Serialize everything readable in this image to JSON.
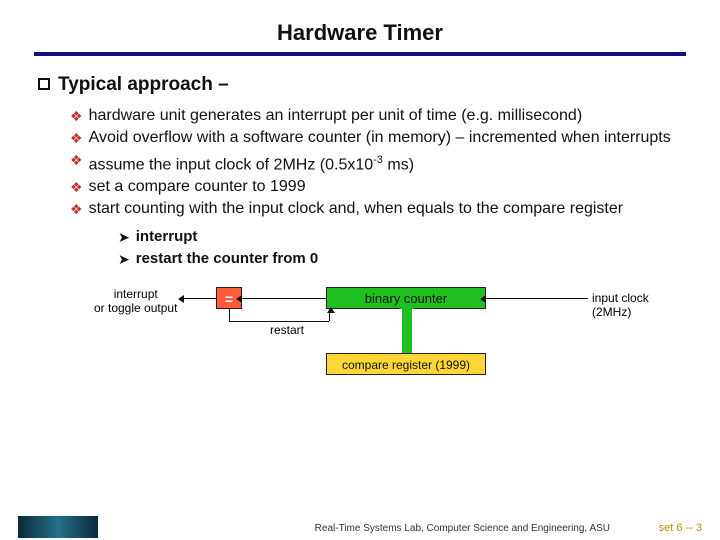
{
  "title": "Hardware Timer",
  "heading": "Typical approach –",
  "bullets2": [
    "hardware unit generates an interrupt per unit of time (e.g. millisecond)",
    "Avoid overflow with a software counter (in memory) – incremented when interrupts",
    "assume the input clock of 2MHz (0.5x10",
    "set a compare counter to 1999",
    "start counting with the input clock and, when equals to the compare register"
  ],
  "bullet2_tail": " ms)",
  "bullet2_sup": "-3",
  "bullets3": [
    "interrupt",
    "restart the counter from 0"
  ],
  "diagram": {
    "interrupt_label_l1": "interrupt",
    "interrupt_label_l2": "or toggle output",
    "eq": "=",
    "counter": "binary counter",
    "clock": "input clock (2MHz)",
    "restart": "restart",
    "cmpreg": "compare register (1999)"
  },
  "footer": {
    "lab": "Real-Time Systems Lab, Computer Science and Engineering, ASU",
    "page": "set 6 -- 3"
  }
}
